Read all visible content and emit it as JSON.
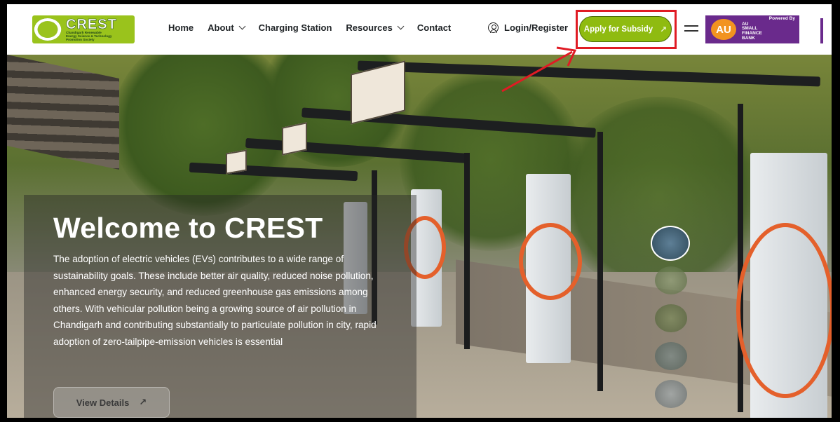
{
  "brand": {
    "name": "CREST",
    "subtitle_lines": [
      "Chandigarh Renewable",
      "Energy Science & Technology",
      "Promotion Society"
    ]
  },
  "nav": {
    "items": [
      {
        "label": "Home",
        "has_dropdown": false
      },
      {
        "label": "About",
        "has_dropdown": true
      },
      {
        "label": "Charging Station",
        "has_dropdown": false
      },
      {
        "label": "Resources",
        "has_dropdown": true
      },
      {
        "label": "Contact",
        "has_dropdown": false
      }
    ],
    "login_label": "Login/Register",
    "apply_label": "Apply for Subsidy",
    "apply_icon": "arrow-up-right-icon",
    "menu_icon": "hamburger-icon"
  },
  "sponsor": {
    "powered_by": "Powered By",
    "logo_letters": "AU",
    "name_lines": [
      "AU",
      "SMALL",
      "FINANCE",
      "BANK"
    ],
    "color": "#6a2a8c",
    "accent": "#f29320"
  },
  "hero": {
    "title": "Welcome to CREST",
    "body": "The adoption of electric vehicles (EVs) contributes to a wide range of sustainability goals. These include better air quality, reduced noise pollution, enhanced energy security, and reduced greenhouse gas emissions among others. With vehicular pollution being a growing source of air pollution in Chandigarh and contributing substantially to particulate pollution in city, rapid adoption of zero-tailpipe-emission vehicles is essential",
    "cta_label": "View Details",
    "cta_icon": "arrow-up-right-icon",
    "slides": [
      {
        "name": "slide-1",
        "active": true
      },
      {
        "name": "slide-2",
        "active": false
      },
      {
        "name": "slide-3",
        "active": false
      },
      {
        "name": "slide-4",
        "active": false
      },
      {
        "name": "slide-5",
        "active": false
      }
    ]
  },
  "colors": {
    "accent_green": "#8fbb10",
    "highlight_red": "#e01b24"
  }
}
